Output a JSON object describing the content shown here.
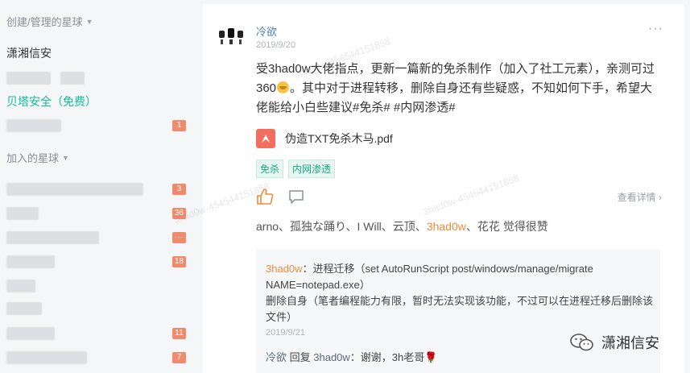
{
  "sidebar": {
    "created_header": "创建/管理的星球",
    "joined_header": "加入的星球",
    "created_items": [
      {
        "label": "潇湘信安"
      },
      {
        "label": ""
      },
      {
        "label": "贝塔安全（免费）"
      },
      {
        "label": "",
        "badge": "1"
      }
    ],
    "joined_badges": [
      "3",
      "36",
      "···",
      "18",
      "11",
      "7"
    ]
  },
  "post": {
    "author": "冷欲",
    "date": "2019/9/20",
    "more": "···",
    "text_part1": "受3had0w大佬指点，更新一篇新的免杀制作（加入了社工元素），亲测可过360",
    "text_part2": "。其中对于进程转移，删除自身还有些疑惑，不知如何下手，希望大佬能给小白些建议#免杀# #内网渗透#",
    "file_name": "伪造TXT免杀木马.pdf",
    "tags": [
      "免杀",
      "内网渗透"
    ],
    "details": "查看详情",
    "likes_before": "arno、孤独な踊り、I Will、云顶、",
    "likes_highlight": "3had0w",
    "likes_after": "、花花 觉得很赞"
  },
  "comments": [
    {
      "name": "3had0w",
      "text": "：进程迁移（set AutoRunScript post/windows/manage/migrate NAME=notepad.exe）\n删除自身（笔者编程能力有限，暂时无法实现该功能，不过可以在进程迁移后删除该文件）",
      "date": "2019/9/21"
    },
    {
      "name": "冷欲",
      "reply_word": " 回复 ",
      "reply_to": "3had0w",
      "text": "：谢谢，3h老哥"
    }
  ],
  "watermark": {
    "brand": "潇湘信安",
    "trace": "3had0w-454544151858"
  },
  "colors": {
    "accent_green": "#16b998",
    "highlight_orange": "#ef8b3b",
    "badge_red": "#f08a6d",
    "author_blue": "#4a7fb5"
  }
}
